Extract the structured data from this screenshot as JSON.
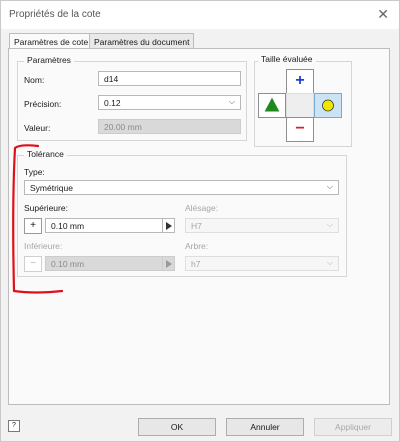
{
  "window": {
    "title": "Propriétés de la cote",
    "close_glyph": "✕"
  },
  "tabs": [
    {
      "label": "Paramètres de cote",
      "active": true
    },
    {
      "label": "Paramètres du document",
      "active": false
    }
  ],
  "parametres": {
    "group_title": "Paramètres",
    "nom_label": "Nom:",
    "nom_value": "d14",
    "precision_label": "Précision:",
    "precision_value": "0.12",
    "valeur_label": "Valeur:",
    "valeur_value": "20.00 mm"
  },
  "taille": {
    "title": "Taille évaluée",
    "plus_glyph": "+",
    "minus_glyph": "−",
    "colors": {
      "plus": "#1f3fd6",
      "minus": "#e21d1d",
      "triangle": "#1e8a1e",
      "circle": "#f2e600"
    }
  },
  "tolerance": {
    "group_title": "Tolérance",
    "type_label": "Type:",
    "type_value": "Symétrique",
    "superieure_label": "Supérieure:",
    "superieure_value": "0.10 mm",
    "superieure_btn": "+",
    "inferieure_label": "Inférieure:",
    "inferieure_value": "0.10 mm",
    "inferieure_btn": "−",
    "alesage_label": "Alésage:",
    "alesage_value": "H7",
    "arbre_label": "Arbre:",
    "arbre_value": "h7"
  },
  "footer": {
    "help_glyph": "?",
    "ok": "OK",
    "annuler": "Annuler",
    "appliquer": "Appliquer"
  },
  "annotation_color": "#e0101a"
}
